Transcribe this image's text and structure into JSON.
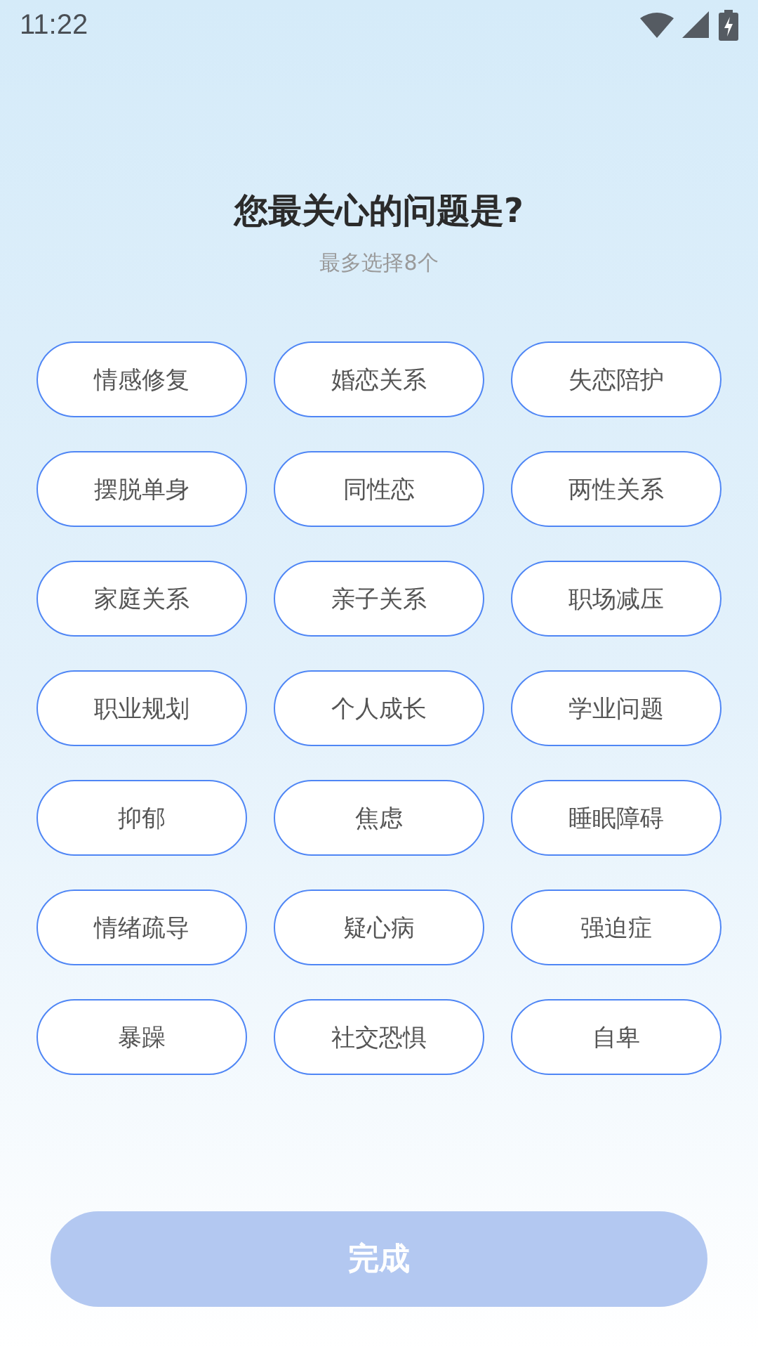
{
  "status_bar": {
    "time": "11:22"
  },
  "title": "您最关心的问题是?",
  "subtitle": "最多选择8个",
  "options": [
    {
      "label": "情感修复",
      "selected": false
    },
    {
      "label": "婚恋关系",
      "selected": false
    },
    {
      "label": "失恋陪护",
      "selected": false
    },
    {
      "label": "摆脱单身",
      "selected": false
    },
    {
      "label": "同性恋",
      "selected": false
    },
    {
      "label": "两性关系",
      "selected": false
    },
    {
      "label": "家庭关系",
      "selected": false
    },
    {
      "label": "亲子关系",
      "selected": false
    },
    {
      "label": "职场减压",
      "selected": false
    },
    {
      "label": "职业规划",
      "selected": false
    },
    {
      "label": "个人成长",
      "selected": false
    },
    {
      "label": "学业问题",
      "selected": false
    },
    {
      "label": "抑郁",
      "selected": false
    },
    {
      "label": "焦虑",
      "selected": false
    },
    {
      "label": "睡眠障碍",
      "selected": false
    },
    {
      "label": "情绪疏导",
      "selected": false
    },
    {
      "label": "疑心病",
      "selected": false
    },
    {
      "label": "强迫症",
      "selected": false
    },
    {
      "label": "暴躁",
      "selected": false
    },
    {
      "label": "社交恐惧",
      "selected": false
    },
    {
      "label": "自卑",
      "selected": false
    }
  ],
  "done_button": {
    "label": "完成",
    "disabled": true
  }
}
